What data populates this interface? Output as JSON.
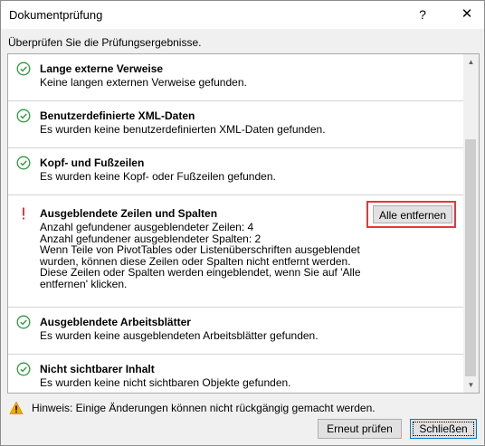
{
  "dialog": {
    "title": "Dokumentprüfung",
    "help_label": "?",
    "close_label": "✕",
    "instruction": "Überprüfen Sie die Prüfungsergebnisse."
  },
  "results": [
    {
      "status": "ok",
      "icon": "check-circle-icon",
      "heading": "Lange externe Verweise",
      "description": "Keine langen externen Verweise gefunden."
    },
    {
      "status": "ok",
      "icon": "check-circle-icon",
      "heading": "Benutzerdefinierte XML-Daten",
      "description": "Es wurden keine benutzerdefinierten XML-Daten gefunden."
    },
    {
      "status": "ok",
      "icon": "check-circle-icon",
      "heading": "Kopf- und Fußzeilen",
      "description": "Es wurden keine Kopf- oder Fußzeilen gefunden."
    },
    {
      "status": "issue",
      "icon": "exclamation-icon",
      "heading": "Ausgeblendete Zeilen und Spalten",
      "description": "Anzahl gefundener ausgeblendeter Zeilen: 4\nAnzahl gefundener ausgeblendeter Spalten: 2\nWenn Teile von PivotTables oder Listenüberschriften ausgeblendet\nwurden, können diese Zeilen oder Spalten nicht entfernt werden.\nDiese Zeilen oder Spalten werden eingeblendet, wenn Sie auf 'Alle\nentfernen' klicken.",
      "action_label": "Alle entfernen"
    },
    {
      "status": "ok",
      "icon": "check-circle-icon",
      "heading": "Ausgeblendete Arbeitsblätter",
      "description": "Es wurden keine ausgeblendeten Arbeitsblätter gefunden."
    },
    {
      "status": "ok",
      "icon": "check-circle-icon",
      "heading": "Nicht sichtbarer Inhalt",
      "description": "Es wurden keine nicht sichtbaren Objekte gefunden."
    }
  ],
  "footer": {
    "note_icon": "warning-triangle-icon",
    "note": "Hinweis: Einige Änderungen können nicht rückgängig gemacht werden.",
    "recheck_label": "Erneut prüfen",
    "close_label": "Schließen"
  },
  "colors": {
    "ok": "#2e9a3e",
    "issue": "#e0393e",
    "warning": "#f2a900",
    "highlight_border": "#e0393e"
  }
}
